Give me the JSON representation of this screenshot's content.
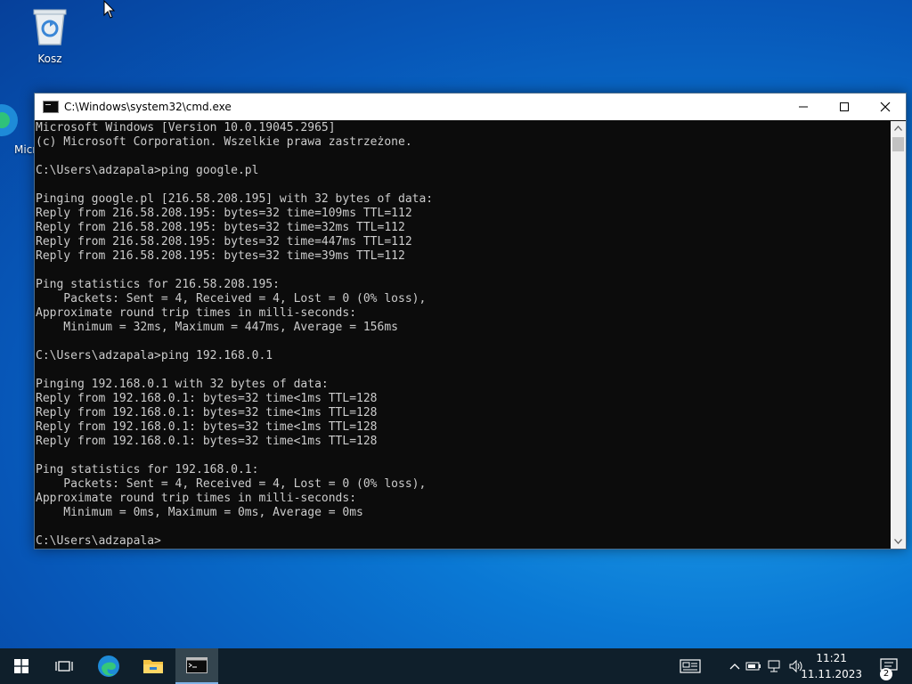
{
  "desktop": {
    "icons": [
      {
        "label": "Kosz"
      },
      {
        "label": "Micr"
      }
    ]
  },
  "window": {
    "title": "C:\\Windows\\system32\\cmd.exe"
  },
  "console": {
    "lines": [
      "Microsoft Windows [Version 10.0.19045.2965]",
      "(c) Microsoft Corporation. Wszelkie prawa zastrzeżone.",
      "",
      "C:\\Users\\adzapala>ping google.pl",
      "",
      "Pinging google.pl [216.58.208.195] with 32 bytes of data:",
      "Reply from 216.58.208.195: bytes=32 time=109ms TTL=112",
      "Reply from 216.58.208.195: bytes=32 time=32ms TTL=112",
      "Reply from 216.58.208.195: bytes=32 time=447ms TTL=112",
      "Reply from 216.58.208.195: bytes=32 time=39ms TTL=112",
      "",
      "Ping statistics for 216.58.208.195:",
      "    Packets: Sent = 4, Received = 4, Lost = 0 (0% loss),",
      "Approximate round trip times in milli-seconds:",
      "    Minimum = 32ms, Maximum = 447ms, Average = 156ms",
      "",
      "C:\\Users\\adzapala>ping 192.168.0.1",
      "",
      "Pinging 192.168.0.1 with 32 bytes of data:",
      "Reply from 192.168.0.1: bytes=32 time<1ms TTL=128",
      "Reply from 192.168.0.1: bytes=32 time<1ms TTL=128",
      "Reply from 192.168.0.1: bytes=32 time<1ms TTL=128",
      "Reply from 192.168.0.1: bytes=32 time<1ms TTL=128",
      "",
      "Ping statistics for 192.168.0.1:",
      "    Packets: Sent = 4, Received = 4, Lost = 0 (0% loss),",
      "Approximate round trip times in milli-seconds:",
      "    Minimum = 0ms, Maximum = 0ms, Average = 0ms",
      "",
      "C:\\Users\\adzapala>"
    ]
  },
  "taskbar": {
    "apps": [
      "start",
      "task-view",
      "edge",
      "file-explorer",
      "command-prompt"
    ],
    "clock": {
      "time": "11:21",
      "date": "11.11.2023"
    },
    "notifications": {
      "count": "2"
    }
  },
  "colors": {
    "console_bg": "#0c0c0c",
    "console_fg": "#cccccc",
    "taskbar": "#0f1f2b",
    "desktop_accent": "#0a78d4"
  }
}
